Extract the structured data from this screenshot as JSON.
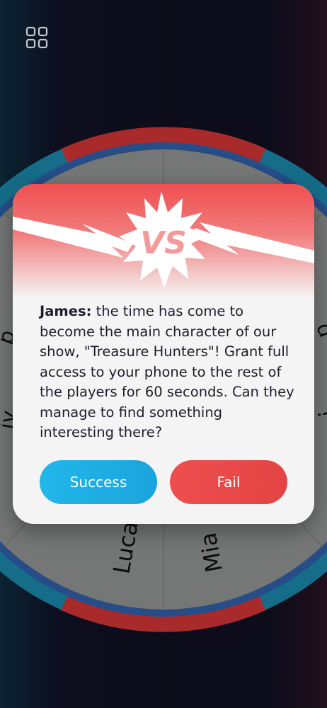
{
  "menu": {
    "icon": "grid-icon"
  },
  "wheel": {
    "players": [
      "Luca",
      "Mia"
    ],
    "colors": {
      "rim_red": "#d93535",
      "rim_blue": "#1a86a8",
      "ring": "#2f5fa6",
      "inner": "#8f9090"
    }
  },
  "card": {
    "badge_text": "VS",
    "speaker": "James:",
    "message": " the time has come to become the main character of our show, \"Treasure Hunters\"! Grant full access to your phone to the rest of the players for 60 seconds. Can they manage to find something interesting there?",
    "success_label": "Success",
    "fail_label": "Fail",
    "colors": {
      "header": "#ef4f50",
      "success": "#22b7ea",
      "fail": "#ee4f4e"
    }
  }
}
